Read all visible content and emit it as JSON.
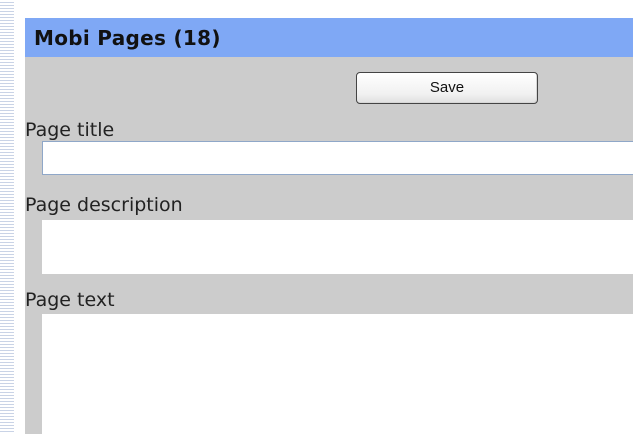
{
  "panel": {
    "title": "Mobi Pages (18)"
  },
  "toolbar": {
    "save_label": "Save"
  },
  "form": {
    "page_title": {
      "label": "Page title",
      "value": ""
    },
    "page_description": {
      "label": "Page description",
      "value": ""
    },
    "page_text": {
      "label": "Page text",
      "value": ""
    }
  },
  "colors": {
    "header_bg": "#7fa8f5",
    "panel_bg": "#cccccc",
    "field_bg": "#ffffff"
  }
}
